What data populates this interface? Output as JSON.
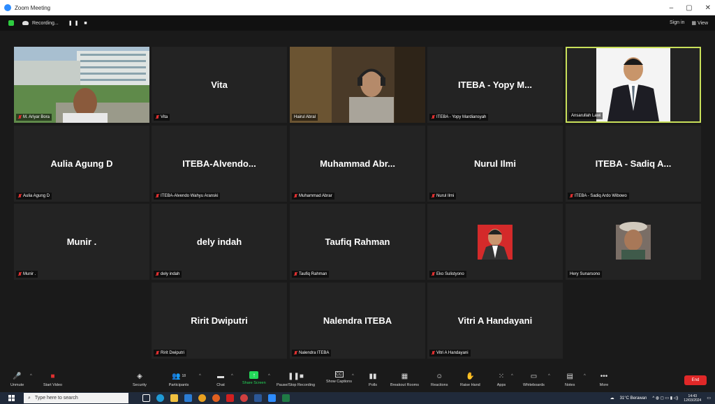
{
  "window": {
    "title": "Zoom Meeting"
  },
  "topbar": {
    "recording_label": "Recording...",
    "sign_in": "Sign in",
    "view": "View"
  },
  "participants": [
    {
      "name": "M. Ariyar Bora",
      "display": "",
      "muted": true,
      "video": "city"
    },
    {
      "name": "Vita",
      "display": "Vita",
      "muted": true,
      "video": ""
    },
    {
      "name": "Hairul Abral",
      "display": "",
      "muted": false,
      "video": "headset"
    },
    {
      "name": "ITEBA - Yopy Mardiansyah",
      "display": "ITEBA - Yopy M...",
      "muted": true,
      "video": ""
    },
    {
      "name": "Ansarullah Lawi",
      "display": "",
      "muted": false,
      "video": "portrait",
      "active": true
    },
    {
      "name": "Aulia Agung D",
      "display": "Aulia Agung D",
      "muted": true,
      "video": ""
    },
    {
      "name": "ITEBA-Alvendo Wahyu Aranski",
      "display": "ITEBA-Alvendo...",
      "muted": true,
      "video": ""
    },
    {
      "name": "Muhammad Abrar",
      "display": "Muhammad  Abr...",
      "muted": true,
      "video": ""
    },
    {
      "name": "Nurul Ilmi",
      "display": "Nurul Ilmi",
      "muted": true,
      "video": ""
    },
    {
      "name": "ITEBA - Sadiq Ardo Wibowo",
      "display": "ITEBA - Sadiq A...",
      "muted": true,
      "video": ""
    },
    {
      "name": "Munir .",
      "display": "Munir .",
      "muted": true,
      "video": ""
    },
    {
      "name": "dely indah",
      "display": "dely indah",
      "muted": true,
      "video": ""
    },
    {
      "name": "Taufiq Rahman",
      "display": "Taufiq Rahman",
      "muted": true,
      "video": ""
    },
    {
      "name": "Eko Sulistyono",
      "display": "",
      "muted": true,
      "video": "avatar-red"
    },
    {
      "name": "Hery Sunarsono",
      "display": "",
      "muted": false,
      "video": "avatar-photo"
    },
    {
      "name": "Ririt Dwiputri",
      "display": "Ririt Dwiputri",
      "muted": true,
      "video": ""
    },
    {
      "name": "Nalendra ITEBA",
      "display": "Nalendra ITEBA",
      "muted": true,
      "video": ""
    },
    {
      "name": "Vitri A Handayani",
      "display": "Vitri A Handayani",
      "muted": true,
      "video": ""
    }
  ],
  "toolbar": {
    "unmute": "Unmute",
    "start_video": "Start Video",
    "security": "Security",
    "participants": "Participants",
    "participants_count": "18",
    "chat": "Chat",
    "share_screen": "Share Screen",
    "pause_recording": "Pause/Stop Recording",
    "captions": "Show Captions",
    "polls": "Polls",
    "breakout": "Breakout Rooms",
    "reactions": "Reactions",
    "raise_hand": "Raise Hand",
    "apps": "Apps",
    "whiteboards": "Whiteboards",
    "notes": "Notes",
    "more": "More",
    "end": "End"
  },
  "taskbar": {
    "search_placeholder": "Type here to search",
    "weather": "31°C  Berawan",
    "time": "14:43",
    "date": "12/03/2024"
  },
  "colors": {
    "active_border": "#c9e05a",
    "end": "#e02828",
    "share": "#23d959"
  }
}
